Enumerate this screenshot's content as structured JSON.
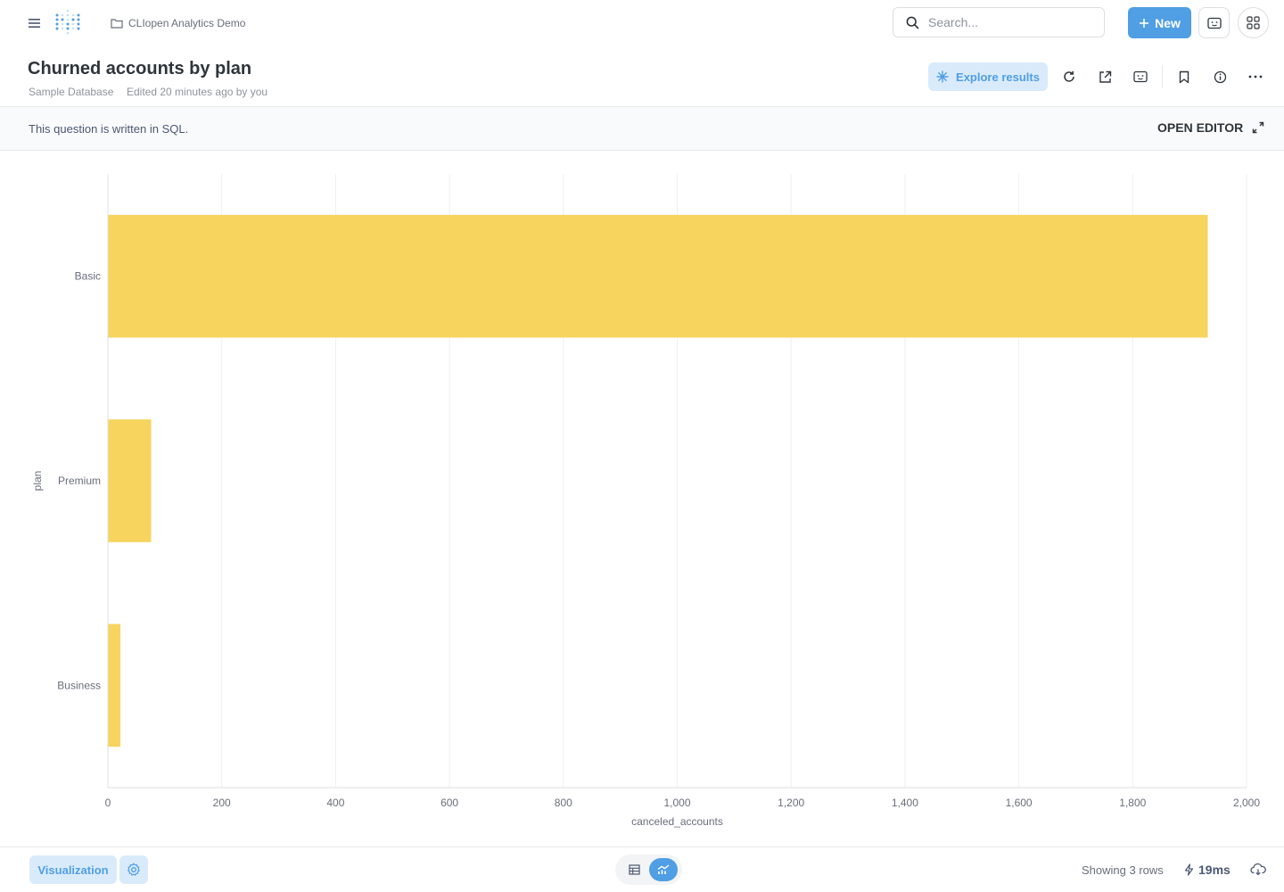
{
  "topbar": {
    "breadcrumb": "CLIopen Analytics Demo",
    "search_placeholder": "Search...",
    "new_label": "New",
    "brand_color": "#509ee3"
  },
  "header": {
    "title": "Churned accounts by plan",
    "database": "Sample Database",
    "edited": "Edited 20 minutes ago by you",
    "explore_label": "Explore results"
  },
  "sql_notice": {
    "message": "This question is written in SQL.",
    "open_editor": "OPEN EDITOR"
  },
  "chart_data": {
    "type": "bar",
    "orientation": "horizontal",
    "categories": [
      "Basic",
      "Premium",
      "Business"
    ],
    "values": [
      1932,
      76,
      22
    ],
    "xlabel": "canceled_accounts",
    "ylabel": "plan",
    "xlim": [
      0,
      2000
    ],
    "xticks": [
      0,
      200,
      400,
      600,
      800,
      1000,
      1200,
      1400,
      1600,
      1800,
      2000
    ],
    "xtick_labels": [
      "0",
      "200",
      "400",
      "600",
      "800",
      "1,000",
      "1,200",
      "1,400",
      "1,600",
      "1,800",
      "2,000"
    ],
    "bar_color": "#f7d45e",
    "grid": true
  },
  "footer": {
    "visualization_label": "Visualization",
    "rows_label": "Showing 3 rows",
    "timing": "19ms"
  }
}
